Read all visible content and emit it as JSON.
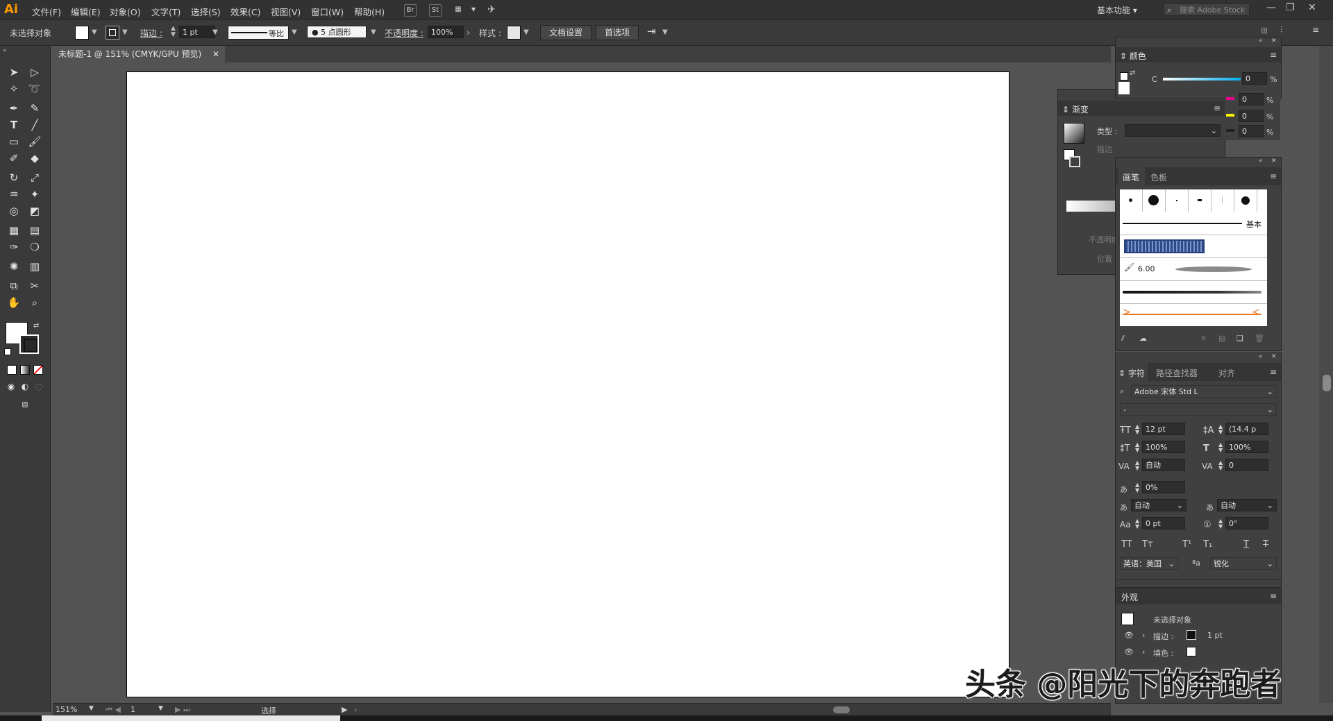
{
  "app": {
    "logo": "Ai"
  },
  "menu": [
    "文件(F)",
    "编辑(E)",
    "对象(O)",
    "文字(T)",
    "选择(S)",
    "效果(C)",
    "视图(V)",
    "窗口(W)",
    "帮助(H)"
  ],
  "menubar": {
    "bridge_icon": "Br",
    "stock_icon": "St",
    "workspace": "基本功能",
    "search_placeholder": "搜索 Adobe Stock"
  },
  "control": {
    "selection": "未选择对象",
    "stroke_label": "描边 :",
    "stroke_weight": "1 pt",
    "stroke_profile": "等比",
    "brush": "5 点圆形",
    "opacity_label": "不透明度 :",
    "opacity": "100%",
    "style_label": "样式 :",
    "doc_setup": "文档设置",
    "preferences": "首选项"
  },
  "document": {
    "tab_title": "未标题-1 @ 151% (CMYK/GPU 预览)"
  },
  "status": {
    "zoom": "151%",
    "artboard": "1",
    "tool": "选择"
  },
  "color_panel": {
    "title": "颜色",
    "channels": [
      {
        "label": "C",
        "value": "0",
        "unit": "%"
      },
      {
        "label": "",
        "value": "0",
        "unit": "%"
      },
      {
        "label": "",
        "value": "0",
        "unit": "%"
      },
      {
        "label": "",
        "value": "0",
        "unit": "%"
      }
    ]
  },
  "gradient_panel": {
    "title": "渐变",
    "type_label": "类型 :",
    "stroke_label": "描边",
    "opacity_label": "不透明度",
    "position_label": "位置"
  },
  "brush_panel": {
    "tabs": [
      "画笔",
      "色板"
    ],
    "basic_label": "基本",
    "size_label": "6.00"
  },
  "char_panel": {
    "tabs": [
      "字符",
      "路径查找器",
      "对齐"
    ],
    "font": "Adobe 宋体 Std L",
    "style": "-",
    "size": "12 pt",
    "leading": "(14.4 p",
    "vscale": "100%",
    "hscale": "100%",
    "kerning": "自动",
    "tracking": "0",
    "tsume": "0%",
    "aki_left": "自动",
    "aki_right": "自动",
    "baseline": "0 pt",
    "rotation": "0°",
    "language": "英语：美国",
    "antialias": "锐化"
  },
  "appearance_panel": {
    "title": "外观",
    "selection": "未选择对象",
    "stroke_label": "描边 :",
    "stroke_value": "1 pt",
    "fill_label": "填色 :"
  },
  "watermark": "头条 @阳光下的奔跑者"
}
